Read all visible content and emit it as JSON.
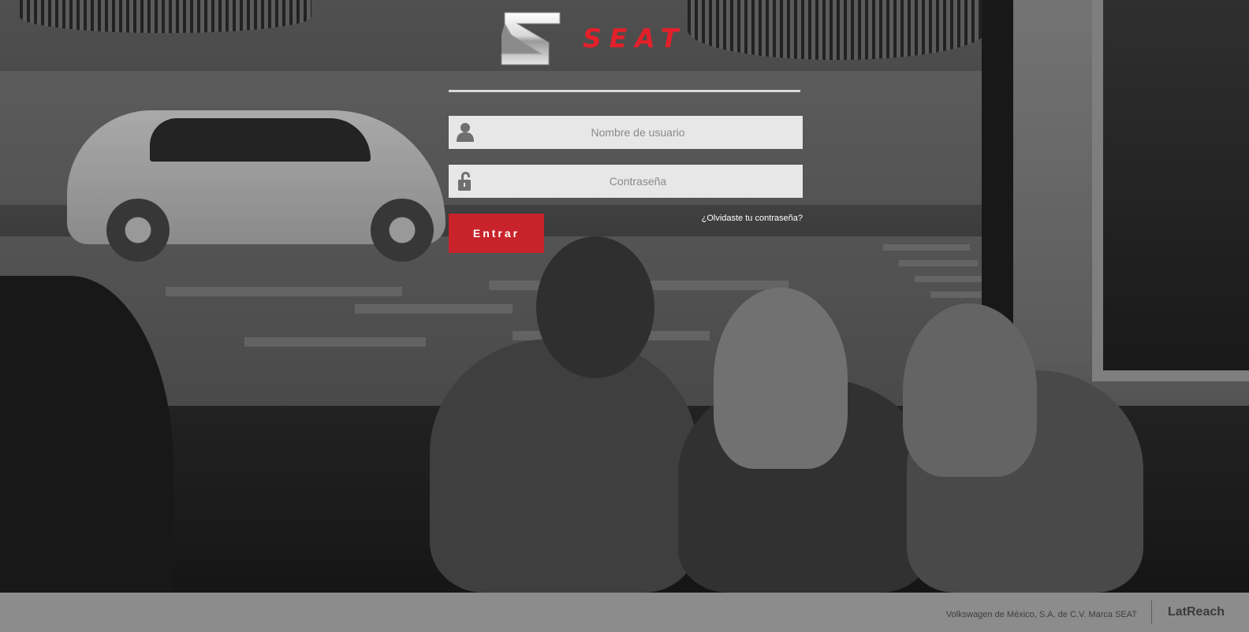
{
  "brand": {
    "wordmark": "SEAT",
    "accent_color": "#e2202a",
    "logo_icon": "seat-s-logo-icon"
  },
  "login": {
    "username": {
      "placeholder": "Nombre de usuario",
      "value": "",
      "icon": "user-icon"
    },
    "password": {
      "placeholder": "Contraseña",
      "value": "",
      "icon": "unlock-icon"
    },
    "submit_label": "Entrar",
    "submit_color": "#c8222a",
    "forgot_label": "¿Olvidaste tu contraseña?"
  },
  "footer": {
    "legal": "Volkswagen de México, S.A. de C.V. Marca SEAT",
    "brand": "LatReach"
  }
}
